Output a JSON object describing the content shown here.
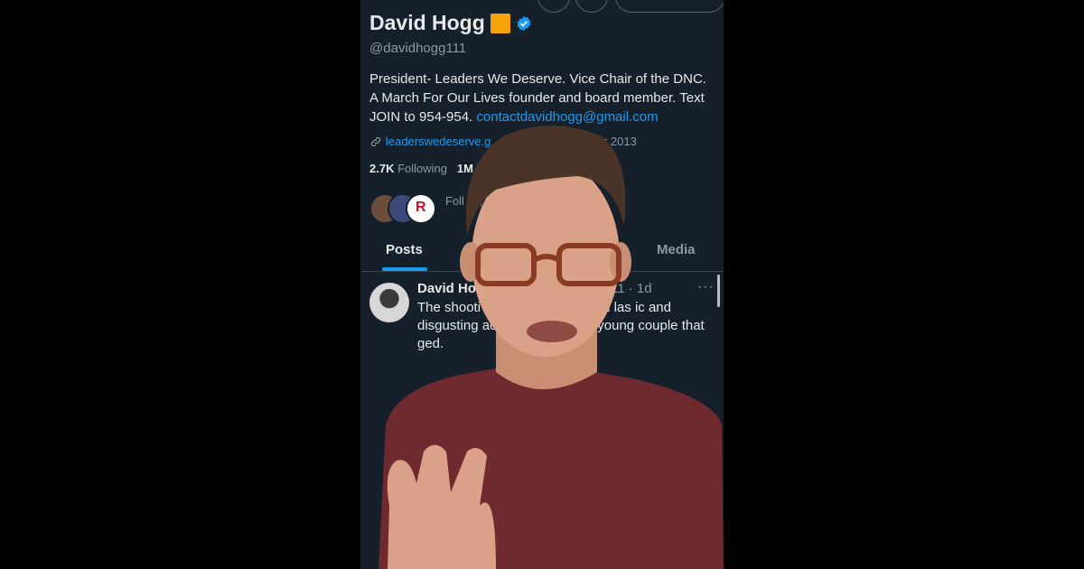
{
  "profile": {
    "name": "David Hogg",
    "handle": "@davidhogg111",
    "bio_text": "President- Leaders We Deserve. Vice Chair of the DNC. A March For Our Lives founder and board member. Text JOIN to 954-954.",
    "bio_email": "contactdavidhogg@gmail.com",
    "website": "leaderswedeserve.g",
    "joined": "eptember 2013",
    "following_count": "2.7K",
    "following_label": "Following",
    "followers_count": "1M",
    "followed_by_text": "Foll                              11, Right Angle Ne"
  },
  "tabs": [
    {
      "label": "Posts",
      "active": true
    },
    {
      "label": "Media",
      "active": false
    }
  ],
  "post": {
    "author": "David Ho",
    "meta": "11 · 1d",
    "more": "···",
    "body": "The shooti                    pital Jewish Museum las                   ic and disgusting act of hatred                inst a young couple that                     ged."
  },
  "colors": {
    "background": "#15202b",
    "accent": "#1d9bf0",
    "text": "#e7e9ea",
    "muted": "#8b98a5",
    "emoji": "#f5a20b"
  },
  "icons": [
    "verified-badge-icon",
    "link-icon",
    "more-options-icon"
  ]
}
